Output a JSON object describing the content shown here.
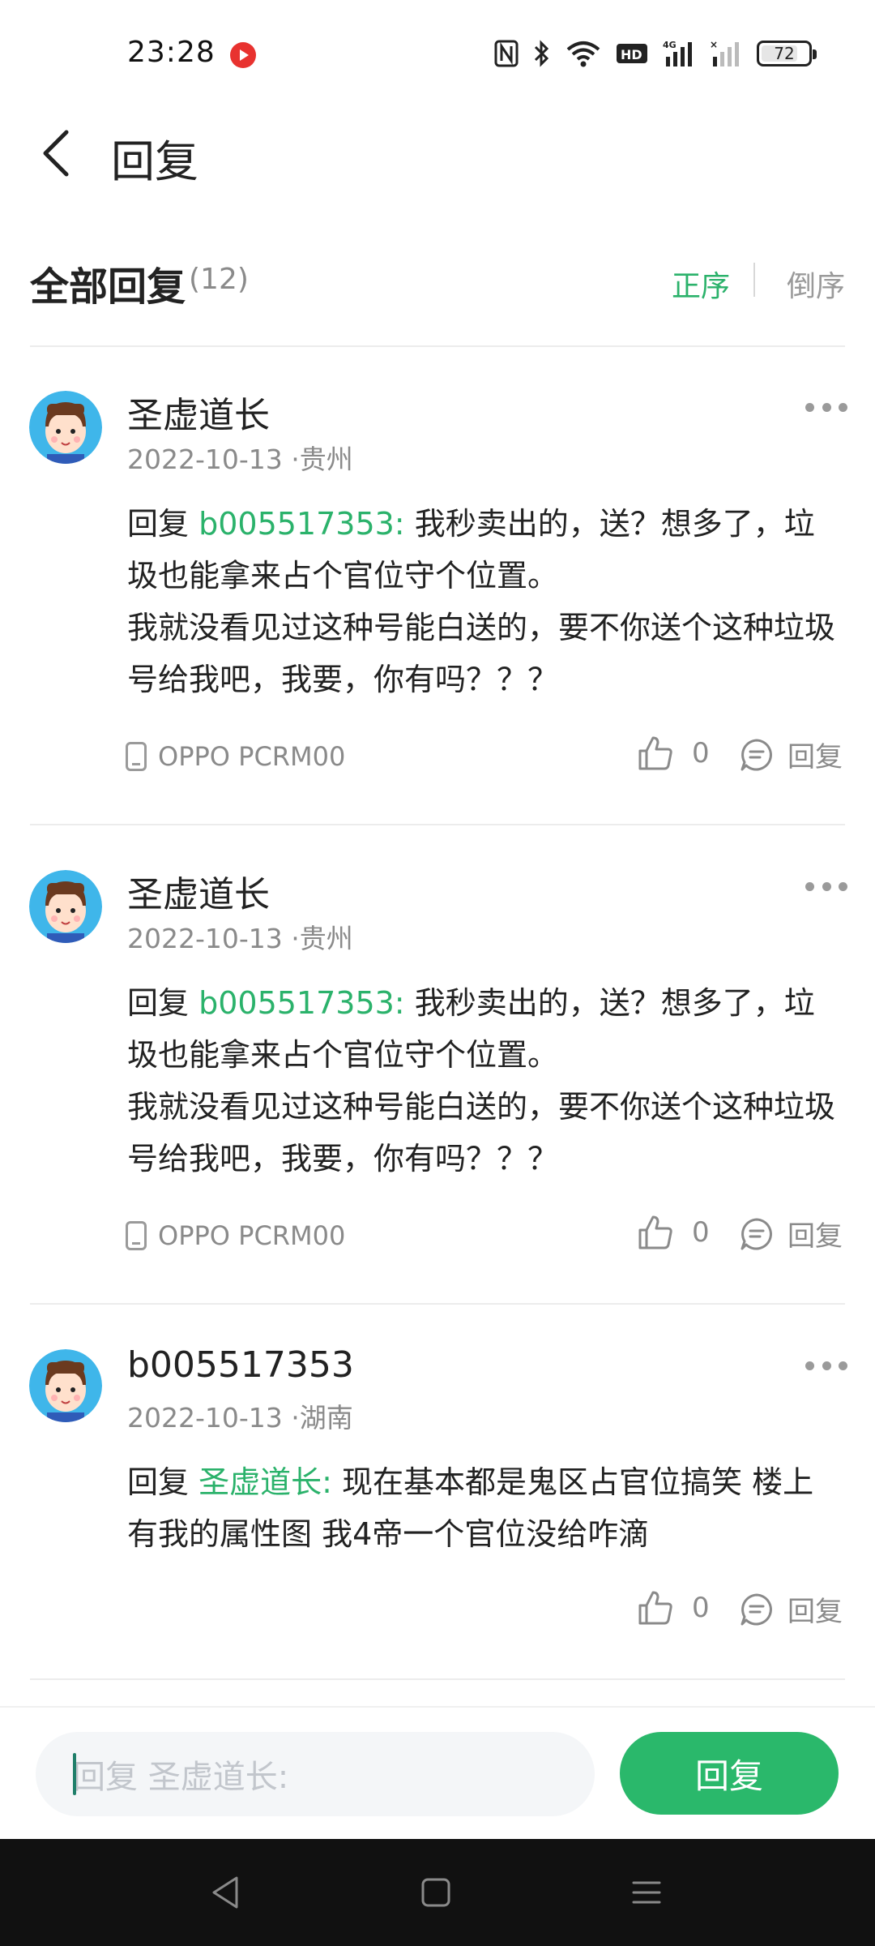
{
  "status_bar": {
    "time": "23:28",
    "battery": "72",
    "icons": [
      "nfc-icon",
      "bluetooth-icon",
      "wifi-icon",
      "hd-icon",
      "signal-4g-icon",
      "signal-icon",
      "battery-icon"
    ]
  },
  "header": {
    "title": "回复"
  },
  "section": {
    "title": "全部回复",
    "count": "(12)",
    "sort_asc": "正序",
    "sort_desc": "倒序",
    "active_sort_color": "#2bb26b"
  },
  "comments": [
    {
      "username": "圣虚道长",
      "date": "2022-10-13",
      "location": " ·贵州",
      "reply_label": "回复 ",
      "mention": "b005517353:",
      "text": " 我秒卖出的，送？想多了，垃圾也能拿来占个官位守个位置。",
      "text2": "我就没看见过这种号能白送的，要不你送个这种垃圾号给我吧，我要，你有吗？？？",
      "device": "OPPO PCRM00",
      "likes": "0",
      "reply_action": "回复"
    },
    {
      "username": "圣虚道长",
      "date": "2022-10-13",
      "location": " ·贵州",
      "reply_label": "回复 ",
      "mention": "b005517353:",
      "text": " 我秒卖出的，送？想多了，垃圾也能拿来占个官位守个位置。",
      "text2": "我就没看见过这种号能白送的，要不你送个这种垃圾号给我吧，我要，你有吗？？？",
      "device": "OPPO PCRM00",
      "likes": "0",
      "reply_action": "回复"
    },
    {
      "username": "b005517353",
      "date": "2022-10-13",
      "location": " ·湖南",
      "reply_label": "回复 ",
      "mention": "圣虚道长:",
      "text": " 现在基本都是鬼区占官位搞笑  楼上有我的属性图  我4帝一个官位没给咋滴",
      "likes": "0",
      "reply_action": "回复"
    }
  ],
  "composer": {
    "placeholder": "回复 圣虚道长:",
    "send_label": "回复",
    "accent_color": "#2ab86b"
  }
}
